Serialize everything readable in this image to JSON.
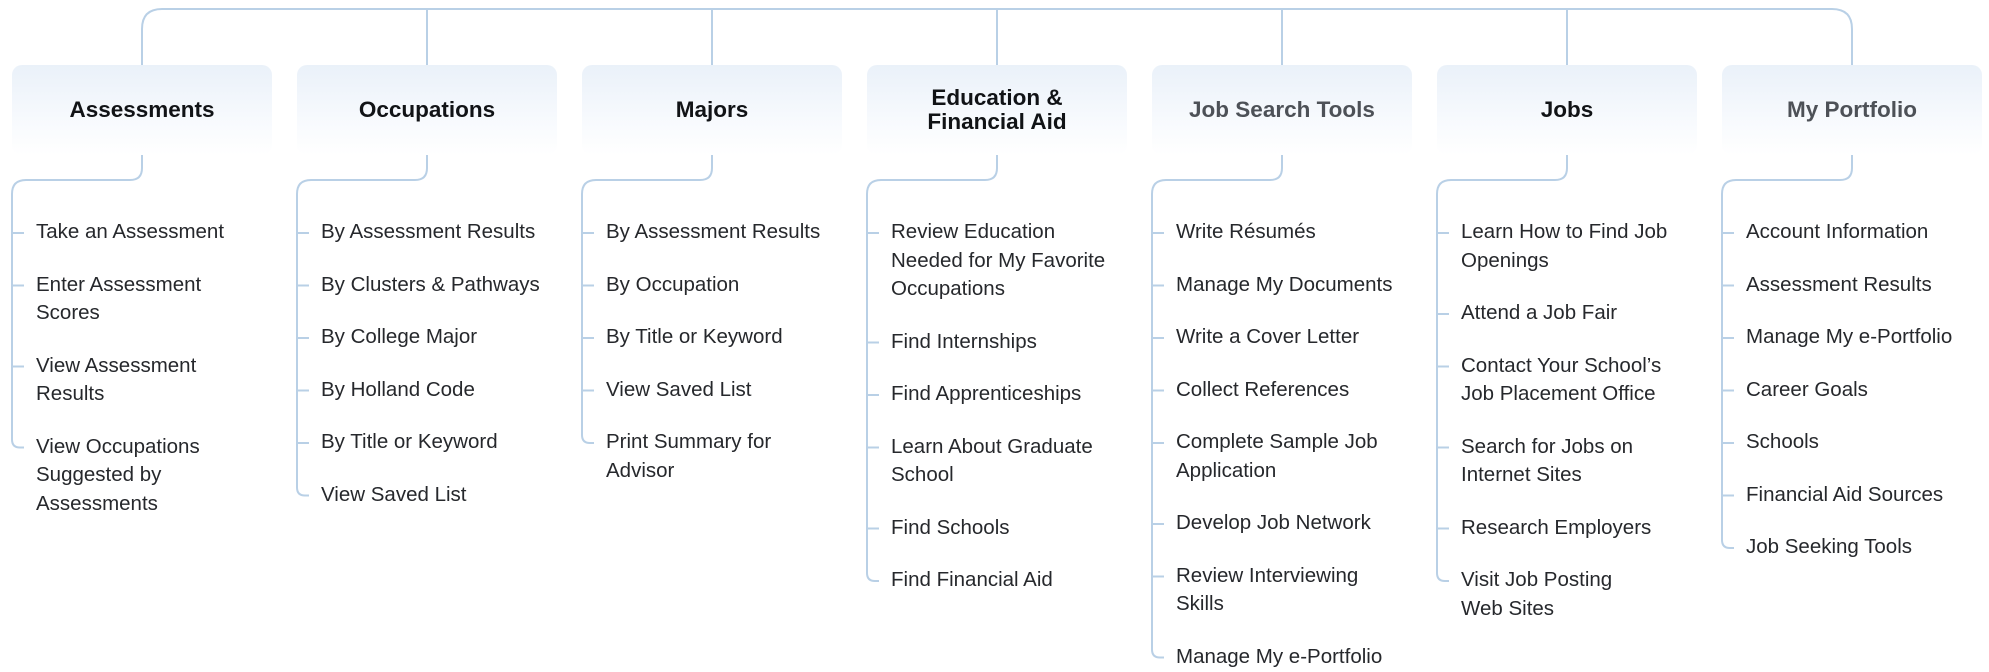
{
  "columns": [
    {
      "header": "Assessments",
      "muted": false,
      "items": [
        [
          "Take an Assessment"
        ],
        [
          "Enter Assessment",
          "Scores"
        ],
        [
          "View Assessment",
          "Results"
        ],
        [
          "View Occupations",
          "Suggested by",
          "Assessments"
        ]
      ]
    },
    {
      "header": "Occupations",
      "muted": false,
      "items": [
        [
          "By Assessment Results"
        ],
        [
          "By Clusters & Pathways"
        ],
        [
          "By College Major"
        ],
        [
          "By Holland Code"
        ],
        [
          "By Title or Keyword"
        ],
        [
          "View Saved List"
        ]
      ]
    },
    {
      "header": "Majors",
      "muted": false,
      "items": [
        [
          "By Assessment Results"
        ],
        [
          "By Occupation"
        ],
        [
          "By Title or Keyword"
        ],
        [
          "View Saved List"
        ],
        [
          "Print Summary for",
          "Advisor"
        ]
      ]
    },
    {
      "header": "Education & Financial Aid",
      "muted": false,
      "header_lines": [
        "Education &",
        "Financial Aid"
      ],
      "items": [
        [
          "Review Education",
          "Needed for My Favorite",
          "Occupations"
        ],
        [
          "Find Internships"
        ],
        [
          "Find Apprenticeships"
        ],
        [
          "Learn About Graduate",
          "School"
        ],
        [
          "Find Schools"
        ],
        [
          "Find Financial Aid"
        ]
      ]
    },
    {
      "header": "Job Search Tools",
      "muted": true,
      "items": [
        [
          "Write Résumés"
        ],
        [
          "Manage My Documents"
        ],
        [
          "Write a Cover Letter"
        ],
        [
          "Collect References"
        ],
        [
          "Complete Sample Job",
          "Application"
        ],
        [
          "Develop Job Network"
        ],
        [
          "Review Interviewing",
          "Skills"
        ],
        [
          "Manage My e-Portfolio"
        ]
      ]
    },
    {
      "header": "Jobs",
      "muted": false,
      "items": [
        [
          "Learn How to Find Job",
          "Openings"
        ],
        [
          "Attend a Job Fair"
        ],
        [
          "Contact Your School’s",
          "Job Placement Office"
        ],
        [
          "Search for Jobs on",
          "Internet Sites"
        ],
        [
          "Research Employers"
        ],
        [
          "Visit Job Posting",
          "Web Sites"
        ]
      ]
    },
    {
      "header": "My Portfolio",
      "muted": true,
      "items": [
        [
          "Account Information"
        ],
        [
          "Assessment Results"
        ],
        [
          "Manage My e-Portfolio"
        ],
        [
          "Career Goals"
        ],
        [
          "Schools"
        ],
        [
          "Financial Aid Sources"
        ],
        [
          "Job Seeking Tools"
        ]
      ]
    }
  ],
  "colors": {
    "connector": "#b9d0e6",
    "header_bg_top": "#eaf1f9",
    "header_text": "#111316",
    "header_text_muted": "#4d5157",
    "item_text": "#26282c"
  }
}
